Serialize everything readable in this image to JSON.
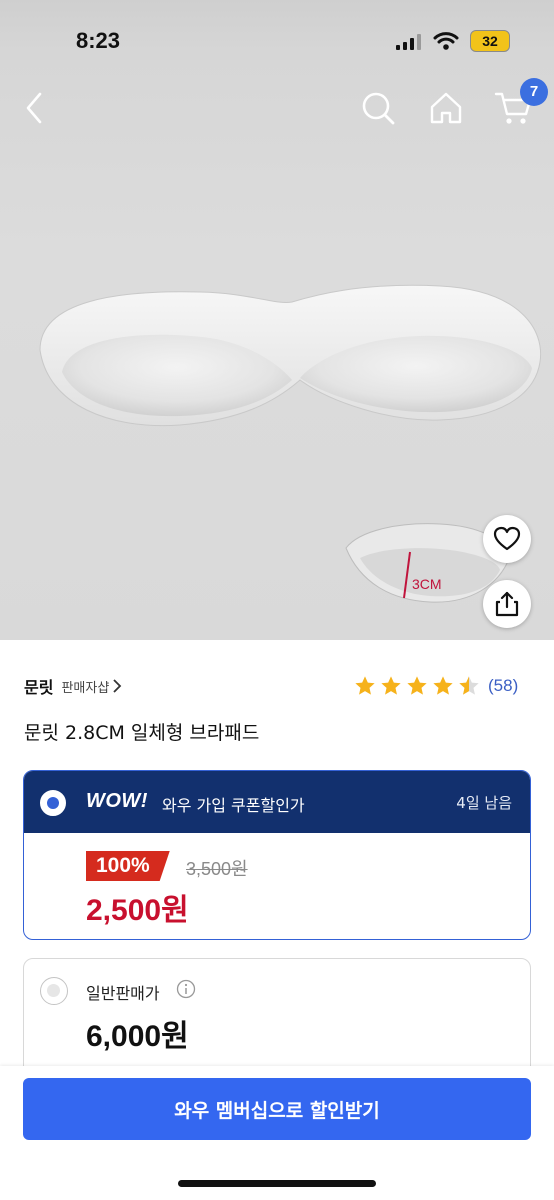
{
  "status_bar": {
    "time": "8:23",
    "battery": "32",
    "battery_color": "#f2c31a",
    "icons": [
      "signal-icon",
      "wifi-icon",
      "battery-icon"
    ]
  },
  "nav": {
    "icons": [
      "back-icon",
      "search-icon",
      "home-icon",
      "cart-icon"
    ],
    "cart_count": "7"
  },
  "product_image": {
    "dimension_label": "3CM",
    "actions": [
      "heart-icon",
      "share-icon"
    ]
  },
  "seller": {
    "brand": "문릿",
    "shop_link": "판매자샵",
    "rating": 4.5,
    "review_count": "(58)",
    "star_color": "#f6b21b"
  },
  "product": {
    "title": "문릿 2.8CM 일체형 브라패드"
  },
  "wow_offer": {
    "logo": "WOW!",
    "label": "와우 가입 쿠폰할인가",
    "remaining": "4일 남음",
    "discount": "100%",
    "original_price": "3,500원",
    "price": "2,500원",
    "selected": true,
    "colors": {
      "header": "#12306e",
      "accent": "#3461d6",
      "price": "#c8102e"
    }
  },
  "regular_offer": {
    "label": "일반판매가",
    "price": "6,000원",
    "selected": false
  },
  "cta": {
    "label": "와우 멤버십으로 할인받기",
    "color": "#3467f0"
  }
}
